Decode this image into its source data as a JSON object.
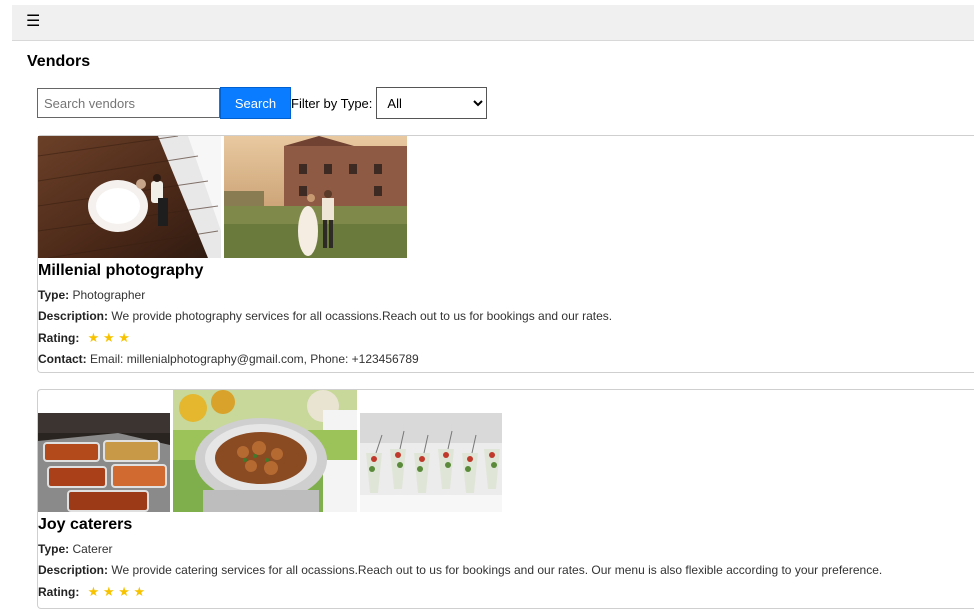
{
  "header": {
    "menu_icon": "hamburger-icon"
  },
  "page": {
    "title": "Vendors"
  },
  "search": {
    "placeholder": "Search vendors",
    "button_label": "Search",
    "filter_label": "Filter by Type:",
    "filter_selected": "All"
  },
  "labels": {
    "type": "Type:",
    "description": "Description:",
    "rating": "Rating:",
    "contact": "Contact:"
  },
  "colors": {
    "accent": "#0a7cff",
    "star": "#f7c300"
  },
  "vendors": [
    {
      "name": "Millenial photography",
      "type": "Photographer",
      "description": "We provide photography services for all ocassions.Reach out to us for bookings and our rates.",
      "rating": 3,
      "stars": "★ ★ ★",
      "contact": "Email: millenialphotography@gmail.com, Phone: +123456789"
    },
    {
      "name": "Joy caterers",
      "type": "Caterer",
      "description": "We provide catering services for all ocassions.Reach out to us for bookings and our rates. Our menu is also flexible according to your preference.",
      "rating": 4,
      "stars": "★ ★ ★ ★"
    }
  ]
}
